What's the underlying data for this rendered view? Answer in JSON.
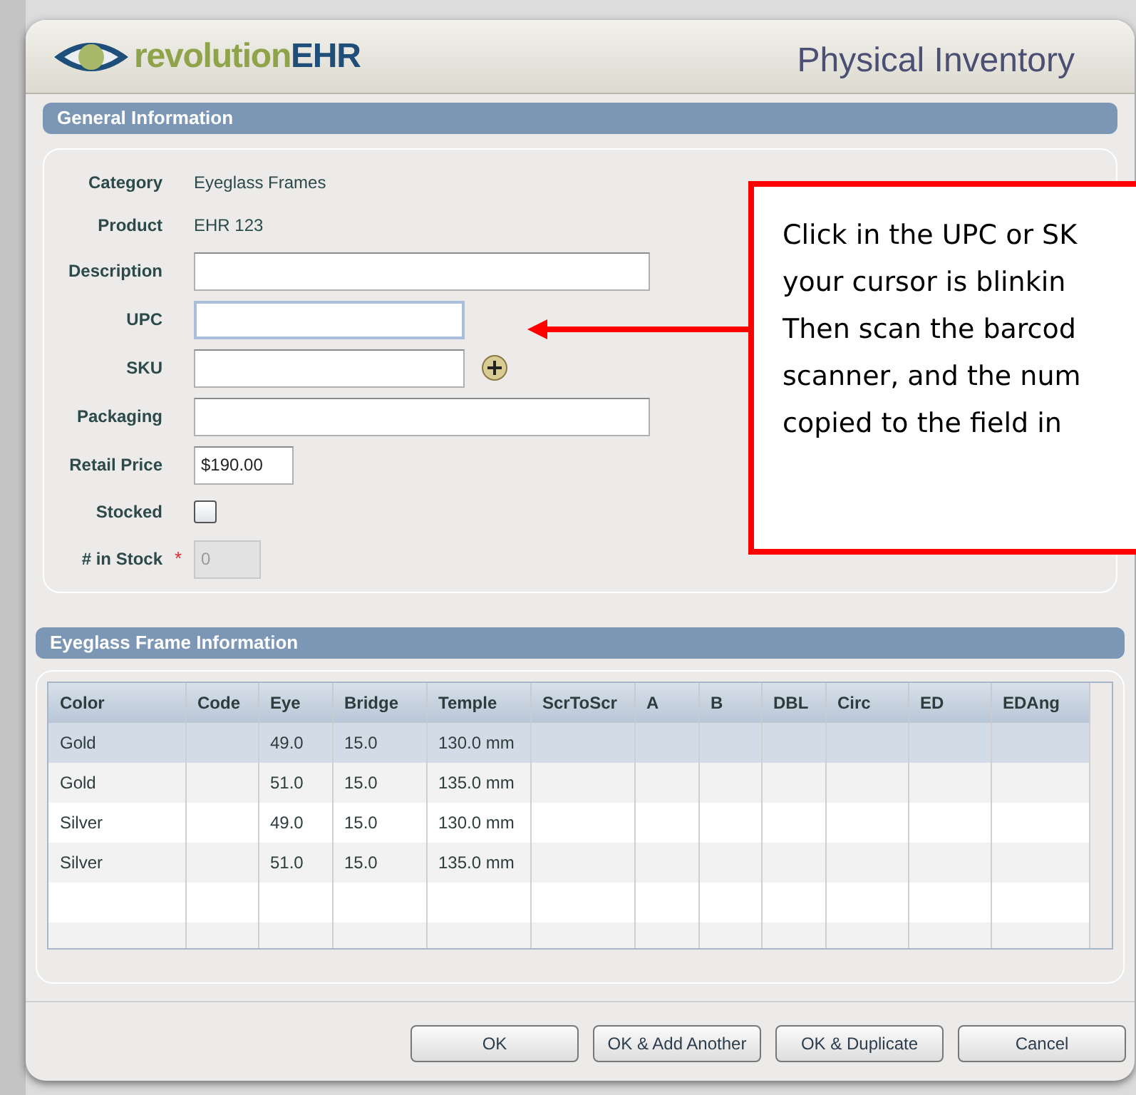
{
  "window": {
    "title": "Physical Inventory",
    "logo": {
      "part_1": "revolution",
      "part_2": "EHR"
    }
  },
  "general_information": {
    "title": "General Information",
    "fields": [
      {
        "kind": "static",
        "label": "Category",
        "value": "Eyeglass Frames"
      },
      {
        "kind": "static",
        "label": "Product",
        "value": "EHR 123"
      },
      {
        "kind": "input",
        "label": "Description",
        "focused": false
      },
      {
        "kind": "input",
        "label": "UPC",
        "focused": true
      },
      {
        "kind": "input",
        "label": "SKU",
        "focused": false,
        "add_button": true
      },
      {
        "kind": "input",
        "label": "Packaging",
        "focused": false
      },
      {
        "kind": "input",
        "label": "Retail Price",
        "focused": false,
        "value": "$190.00"
      },
      {
        "kind": "checkbox",
        "label": "Stocked",
        "checked": false
      },
      {
        "kind": "input",
        "label": "# in Stock",
        "focused": false,
        "disabled": true,
        "required_mark": "*",
        "value": "0"
      }
    ]
  },
  "frame_information": {
    "title": "Eyeglass Frame Information",
    "table": {
      "columns": [
        "Color",
        "Code",
        "Eye",
        "Bridge",
        "Temple",
        "ScrToScr",
        "A",
        "B",
        "DBL",
        "Circ",
        "ED",
        "EDAng"
      ],
      "rows": [
        {
          "selected": true,
          "cells": [
            "Gold",
            "",
            "49.0",
            "15.0",
            "130.0 mm"
          ]
        },
        {
          "selected": false,
          "cells": [
            "Gold",
            "",
            "51.0",
            "15.0",
            "135.0 mm"
          ]
        },
        {
          "selected": false,
          "cells": [
            "Silver",
            "",
            "49.0",
            "15.0",
            "130.0 mm"
          ]
        },
        {
          "selected": false,
          "cells": [
            "Silver",
            "",
            "51.0",
            "15.0",
            "135.0 mm"
          ]
        }
      ]
    }
  },
  "buttons": [
    "OK",
    "OK & Add Another",
    "OK & Duplicate",
    "Cancel"
  ],
  "callout": {
    "lines": [
      "Click in the UPC or SK",
      "your cursor is blinkin",
      "Then scan the barcod",
      "scanner, and the num",
      "copied to the field in"
    ]
  }
}
